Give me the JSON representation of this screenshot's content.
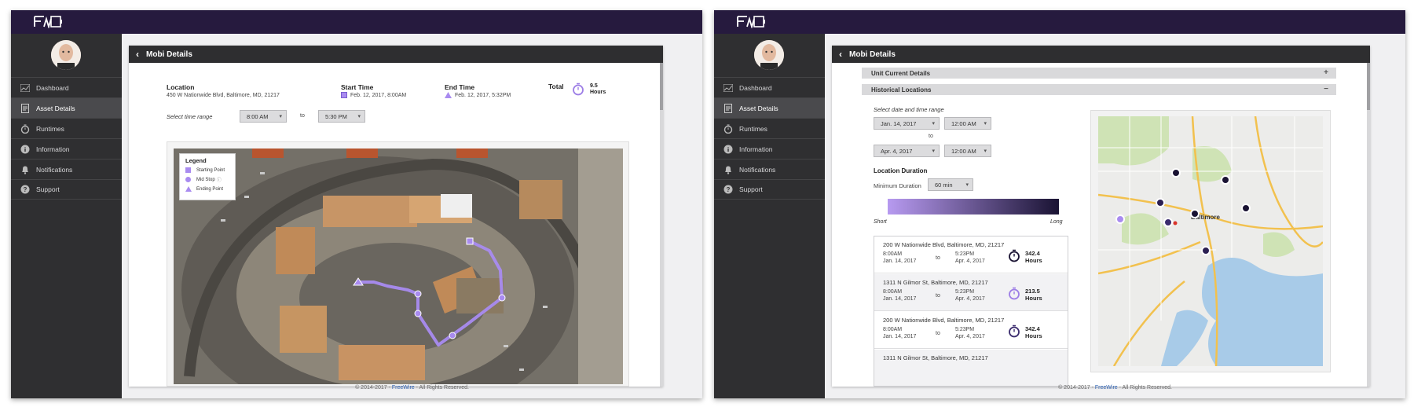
{
  "app": {
    "brand_logo": "FW-logo",
    "footer": {
      "prefix": "© 2014-2017 - ",
      "brand": "FreeWire",
      "suffix": " - All Rights Reserved."
    }
  },
  "sidebar": {
    "items": [
      {
        "label": "Dashboard",
        "icon": "chart-icon"
      },
      {
        "label": "Asset Details",
        "icon": "document-icon"
      },
      {
        "label": "Runtimes",
        "icon": "stopwatch-icon"
      },
      {
        "label": "Information",
        "icon": "info-icon"
      },
      {
        "label": "Notifications",
        "icon": "bell-icon"
      },
      {
        "label": "Support",
        "icon": "help-icon"
      }
    ],
    "active": "Asset Details"
  },
  "screen_a": {
    "title": "Mobi Details",
    "location": {
      "label": "Location",
      "value": "450 W Nationwide Blvd, Baltimore, MD, 21217"
    },
    "start_time": {
      "label": "Start Time",
      "value": "Feb. 12, 2017, 8:00AM"
    },
    "end_time": {
      "label": "End Time",
      "value": "Feb. 12, 2017, 5:32PM"
    },
    "total": {
      "label": "Total",
      "value": "9.5",
      "unit": "Hours"
    },
    "range": {
      "label": "Select time range",
      "from": "8:00 AM",
      "to_label": "to",
      "to": "5:30 PM"
    },
    "legend": {
      "title": "Legend",
      "items": [
        "Starting Point",
        "Mid Stop",
        "Ending Point"
      ]
    }
  },
  "screen_b": {
    "title": "Mobi Details",
    "accordion": [
      {
        "label": "Unit Current Details",
        "sign": "+"
      },
      {
        "label": "Historical Locations",
        "sign": "−"
      }
    ],
    "range": {
      "label": "Select date and time range",
      "start_date": "Jan. 14, 2017",
      "start_time": "12:00 AM",
      "to_label": "to",
      "end_date": "Apr. 4, 2017",
      "end_time": "12:00 AM"
    },
    "duration": {
      "title": "Location Duration",
      "min_label": "Minimum Duration",
      "min_value": "60 min",
      "short_label": "Short",
      "long_label": "Long",
      "gradient_from": "#b79af0",
      "gradient_to": "#1a1333"
    },
    "history": [
      {
        "address": "200 W Nationwide Blvd, Baltimore, MD, 21217",
        "start_time": "8:00AM",
        "start_date": "Jan. 14, 2017",
        "to": "to",
        "end_time": "5:23PM",
        "end_date": "Apr. 4, 2017",
        "duration": "342.4",
        "unit": "Hours",
        "icon_color": "#1a1333"
      },
      {
        "address": "1311 N Gilmor St, Baltimore, MD, 21217",
        "start_time": "8:00AM",
        "start_date": "Jan. 14, 2017",
        "to": "to",
        "end_time": "5:23PM",
        "end_date": "Apr. 4, 2017",
        "duration": "213.5",
        "unit": "Hours",
        "icon_color": "#9d7ee6"
      },
      {
        "address": "200 W Nationwide Blvd, Baltimore, MD, 21217",
        "start_time": "8:00AM",
        "start_date": "Jan. 14, 2017",
        "to": "to",
        "end_time": "5:23PM",
        "end_date": "Apr. 4, 2017",
        "duration": "342.4",
        "unit": "Hours",
        "icon_color": "#3b2c6e"
      },
      {
        "address": "1311 N Gilmor St, Baltimore, MD, 21217"
      }
    ],
    "map_label": "Baltimore"
  },
  "colors": {
    "topbar": "#261a3e",
    "sidebar": "#2f2f31",
    "accent": "#9d7ee6",
    "route": "#a98bf0"
  }
}
